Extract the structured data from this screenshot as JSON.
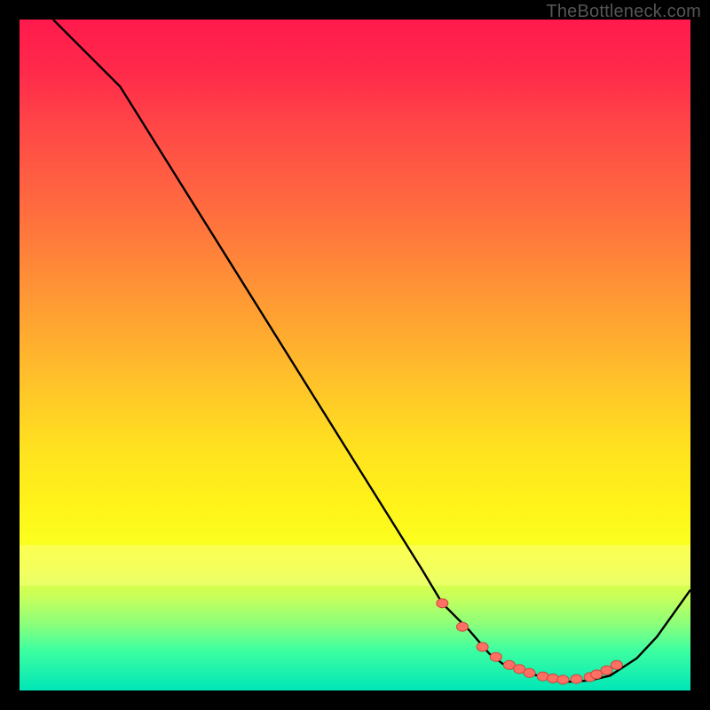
{
  "watermark": "TheBottleneck.com",
  "colors": {
    "background": "#000000",
    "curve": "#000000",
    "dot_fill": "#ff6f63",
    "dot_stroke": "#c94a3f"
  },
  "chart_data": {
    "type": "line",
    "title": "",
    "xlabel": "",
    "ylabel": "",
    "xlim": [
      0,
      100
    ],
    "ylim": [
      0,
      100
    ],
    "grid": false,
    "legend": false,
    "x": [
      5,
      10,
      15,
      20,
      25,
      30,
      35,
      40,
      45,
      50,
      55,
      60,
      63,
      67,
      70,
      72,
      75,
      78,
      80,
      82,
      85,
      88,
      92,
      95,
      100
    ],
    "values": [
      100,
      95,
      90,
      82,
      74,
      66,
      58,
      50,
      42,
      34,
      26,
      18,
      13,
      9,
      5.5,
      4,
      2.8,
      2.0,
      1.5,
      1.3,
      1.5,
      2.2,
      4.8,
      8,
      15
    ],
    "dots_x": [
      63,
      66,
      69,
      71,
      73,
      74.5,
      76,
      78,
      79.5,
      81,
      83,
      85,
      86,
      87.5,
      89
    ],
    "dots_y": [
      13,
      9.5,
      6.5,
      5,
      3.8,
      3.2,
      2.6,
      2.1,
      1.8,
      1.6,
      1.7,
      2.0,
      2.4,
      3.0,
      3.8
    ]
  }
}
